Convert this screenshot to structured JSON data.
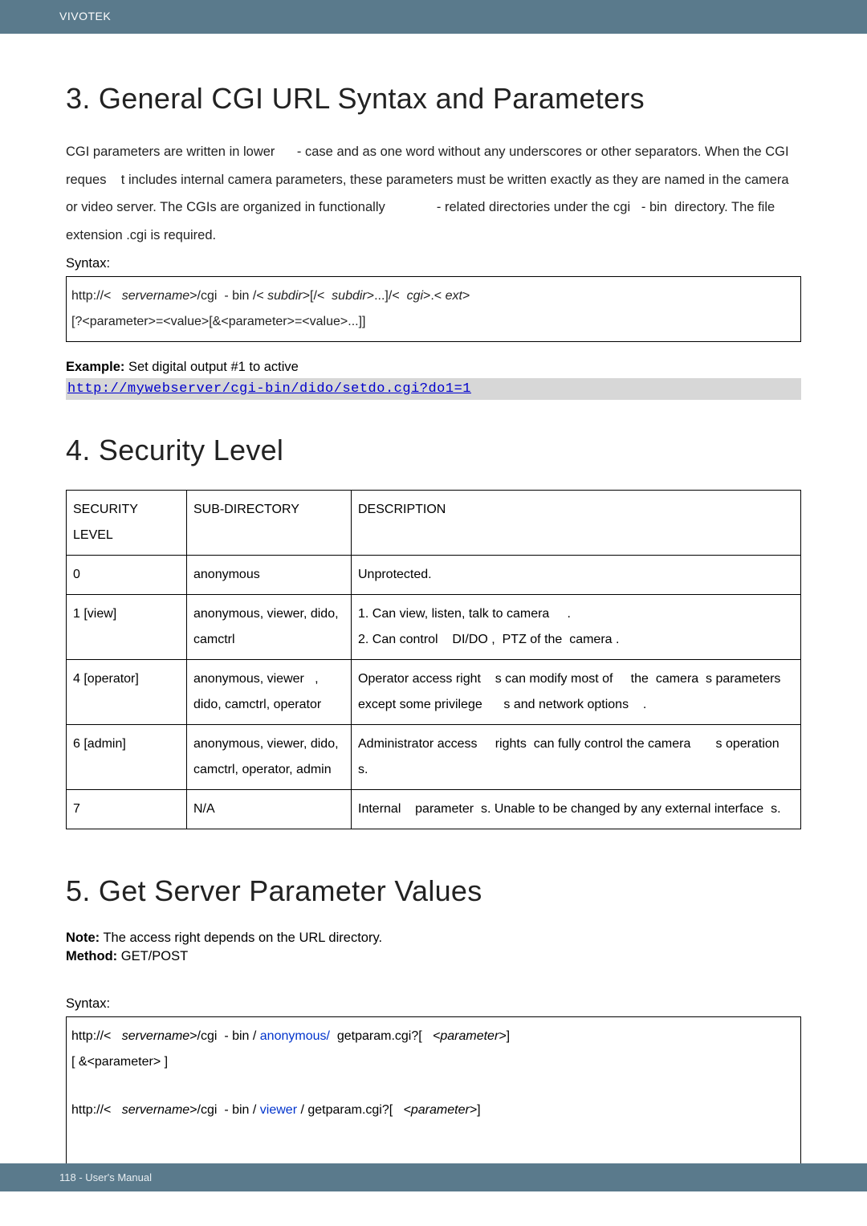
{
  "header": {
    "brand": "VIVOTEK"
  },
  "section3": {
    "title": "3. General CGI URL Syntax and Parameters",
    "para": "CGI parameters are written in lower      - case and as one word without any underscores or other separators. When the CGI reques    t includes internal camera parameters, these parameters must be written exactly as they are named in the camera or video server. The CGIs are organized in functionally              - related directories under the cgi   - bin  directory. The file extension .cgi is required.",
    "syntax_label": "Syntax:",
    "syntax_line1_a": "http://<   ",
    "syntax_line1_b": "servername",
    "syntax_line1_c": ">/cgi  - bin /< ",
    "syntax_line1_d": "subdir",
    "syntax_line1_e": ">[/<  ",
    "syntax_line1_f": "subdir",
    "syntax_line1_g": ">...]/<  ",
    "syntax_line1_h": "cgi",
    "syntax_line1_i": ">.< ",
    "syntax_line1_j": "ext",
    "syntax_line1_k": ">",
    "syntax_line2": "[?<parameter>=<value>[&<parameter>=<value>...]]",
    "example_label": "Example:",
    "example_text": " Set digital output #1 to active",
    "example_url": "http://mywebserver/cgi-bin/dido/setdo.cgi?do1=1"
  },
  "section4": {
    "title": "4. Security Level",
    "headers": [
      "SECURITY LEVEL",
      "SUB-DIRECTORY",
      "DESCRIPTION"
    ],
    "rows": [
      {
        "level": "0",
        "subdir": "anonymous",
        "desc": "Unprotected."
      },
      {
        "level": "1 [view]",
        "subdir": "anonymous, viewer, dido, camctrl",
        "desc": "1. Can view, listen, talk to camera     .\n2. Can control    DI/DO ,  PTZ of the  camera ."
      },
      {
        "level": "4 [operator]",
        "subdir": "anonymous, viewer   , dido, camctrl, operator",
        "desc": "Operator access right    s can modify most of     the  camera  s parameters except some privilege      s and network options    ."
      },
      {
        "level": "6 [admin]",
        "subdir": "anonymous, viewer, dido, camctrl, operator, admin",
        "desc": "Administrator access     rights  can fully control the camera       s operation  s."
      },
      {
        "level": "7",
        "subdir": "N/A",
        "desc": "Internal    parameter  s. Unable to be changed by any external interface  s."
      }
    ]
  },
  "section5": {
    "title": "5. Get Server Parameter Values",
    "note_label": "Note:",
    "note_text": " The access right depends on the URL directory.",
    "method_label": "Method:",
    "method_text": " GET/POST",
    "syntax_label": "Syntax:",
    "s1_a": "http://<   ",
    "s1_b": "servername",
    "s1_c": ">/cgi  - bin / ",
    "s1_d": "anonymous/",
    "s1_e": "  getparam.cgi?[   ",
    "s1_f": "<parameter>",
    "s1_g": "]",
    "s2": "[ &<parameter> ]",
    "s3_a": "http://<   ",
    "s3_b": "servername",
    "s3_c": ">/cgi  - bin / ",
    "s3_d": "viewer",
    "s3_e": " / getparam.cgi?[   ",
    "s3_f": "<parameter>",
    "s3_g": "]"
  },
  "footer": {
    "text": "118 - User's Manual"
  }
}
